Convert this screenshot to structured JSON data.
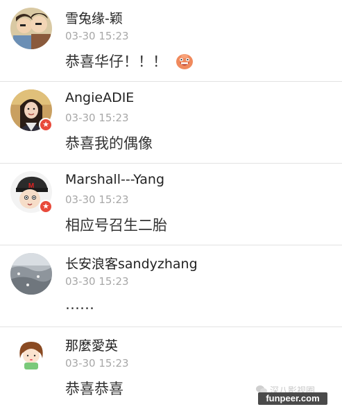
{
  "comments": [
    {
      "name": "雪兔缘-颖",
      "time": "03-30 15:23",
      "text": "恭喜华仔！！！",
      "emoji": "smiling-face-emoji",
      "badge": false
    },
    {
      "name": "AngieADIE",
      "time": "03-30 15:23",
      "text": "恭喜我的偶像",
      "badge": true
    },
    {
      "name": "Marshall---Yang",
      "time": "03-30 15:23",
      "text": "相应号召生二胎",
      "badge": true
    },
    {
      "name": "长安浪客sandyzhang",
      "time": "03-30 15:23",
      "text": "……",
      "badge": false
    },
    {
      "name": "那麼愛英",
      "time": "03-30 15:23",
      "text": "恭喜恭喜",
      "badge": false
    }
  ],
  "badge_symbol": "★",
  "watermark": {
    "text": "深八影视圈",
    "icon": "wechat-icon"
  },
  "brand": {
    "text": "funpeer.com"
  },
  "colors": {
    "badge": "#e84a3b",
    "time": "#a7a7a7",
    "divider": "#e2e2e2"
  }
}
